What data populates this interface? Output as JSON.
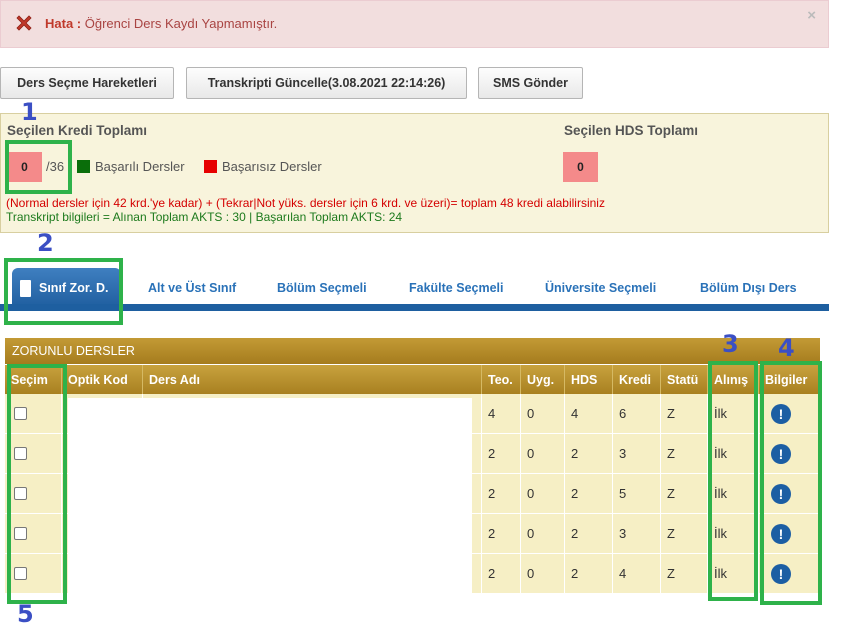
{
  "alert": {
    "label": "Hata",
    "sep": " :",
    "message": " Öğrenci Ders Kaydı Yapmamıştır.",
    "close": "×"
  },
  "toolbar": {
    "movements": "Ders Seçme Hareketleri",
    "transcript": "Transkripti Güncelle(3.08.2021 22:14:26)",
    "sms": "SMS Gönder"
  },
  "credits": {
    "selected_title": "Seçilen Kredi Toplamı",
    "selected_value": "0",
    "selected_max": "/36",
    "legend_success": "Başarılı Dersler",
    "legend_fail": "Başarısız Dersler",
    "hds_title": "Seçilen HDS Toplamı",
    "hds_value": "0",
    "note_red": "(Normal dersler için 42 krd.'ye kadar) + (Tekrar|Not yüks. dersler için 6 krd. ve üzeri)= toplam 48 kredi alabilirsiniz",
    "note_green": "Transkript bilgileri = Alınan Toplam AKTS : 30 | Başarılan Toplam AKTS: 24",
    "colors": {
      "success": "#0a6e0a",
      "fail": "#e60000"
    }
  },
  "tabs": [
    {
      "label": "Sınıf Zor. D."
    },
    {
      "label": "Alt ve Üst Sınıf"
    },
    {
      "label": "Bölüm Seçmeli"
    },
    {
      "label": "Fakülte Seçmeli"
    },
    {
      "label": "Üniversite Seçmeli"
    },
    {
      "label": "Bölüm Dışı Ders"
    }
  ],
  "section_title": "ZORUNLU DERSLER",
  "columns": [
    "Seçim",
    "Optik Kod",
    "Ders Adı",
    "Teo.",
    "Uyg.",
    "HDS",
    "Kredi",
    "Statü",
    "Alınış",
    "Bilgiler"
  ],
  "rows": [
    {
      "teo": "4",
      "uyg": "0",
      "hds": "4",
      "kredi": "6",
      "statu": "Z",
      "alinis": "İlk"
    },
    {
      "teo": "2",
      "uyg": "0",
      "hds": "2",
      "kredi": "3",
      "statu": "Z",
      "alinis": "İlk"
    },
    {
      "teo": "2",
      "uyg": "0",
      "hds": "2",
      "kredi": "5",
      "statu": "Z",
      "alinis": "İlk"
    },
    {
      "teo": "2",
      "uyg": "0",
      "hds": "2",
      "kredi": "3",
      "statu": "Z",
      "alinis": "İlk"
    },
    {
      "teo": "2",
      "uyg": "0",
      "hds": "2",
      "kredi": "4",
      "statu": "Z",
      "alinis": "İlk"
    }
  ],
  "info_glyph": "!",
  "annotations": [
    "1",
    "2",
    "3",
    "4",
    "5"
  ]
}
